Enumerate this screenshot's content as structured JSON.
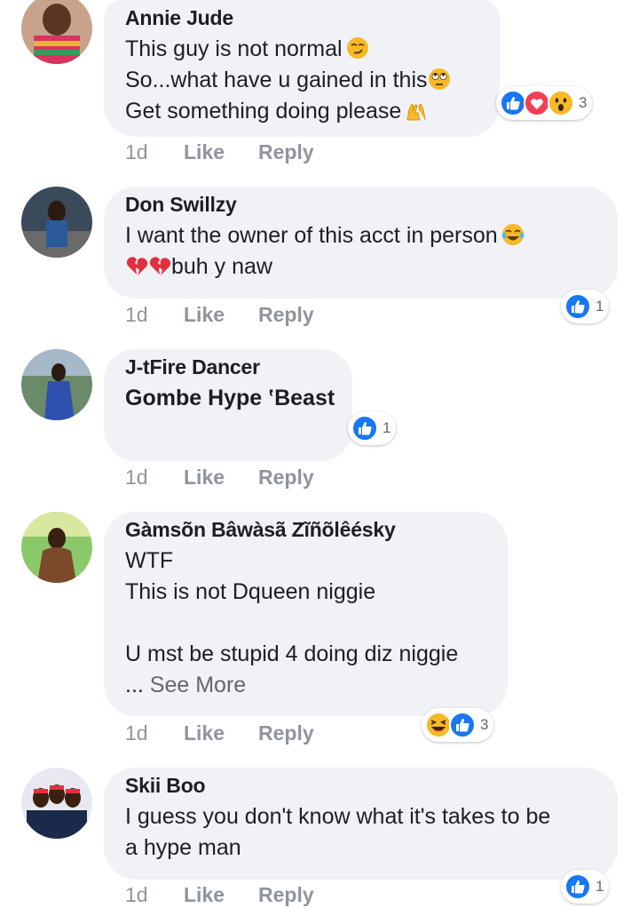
{
  "actions": {
    "like_label": "Like",
    "reply_label": "Reply"
  },
  "comments": [
    {
      "author": "Annie Jude",
      "lines": [
        "This guy is not normal",
        "So...what have u gained in this",
        "Get something doing please"
      ],
      "time": "1d",
      "reactions": {
        "icons": [
          "like-icon",
          "love-icon",
          "wow-icon"
        ],
        "count": "3"
      }
    },
    {
      "author": "Don Swillzy",
      "lines": [
        "I want the owner of this acct in person",
        "buh y naw"
      ],
      "time": "1d",
      "reactions": {
        "icons": [
          "like-icon"
        ],
        "count": "1"
      }
    },
    {
      "author": "J-tFire Dancer",
      "lines": [
        "Gombe Hype ‛Beast"
      ],
      "time": "1d",
      "reactions": {
        "icons": [
          "like-icon"
        ],
        "count": "1"
      }
    },
    {
      "author": "Gàmsõn Bâwàsã Zĩñõlêésky",
      "lines": [
        "WTF",
        "This is not Dqueen niggie",
        "",
        "U mst be stupid 4 doing diz niggie"
      ],
      "see_more_prefix": "...",
      "see_more": "See More",
      "time": "1d",
      "reactions": {
        "icons": [
          "haha-icon",
          "like-icon"
        ],
        "count": "3"
      }
    },
    {
      "author": "Skii Boo",
      "lines": [
        "I guess you don't know what it's takes to be",
        "a hype man"
      ],
      "time": "1d",
      "reactions": {
        "icons": [
          "like-icon"
        ],
        "count": "1"
      }
    }
  ],
  "colors": {
    "bubble": "#f0f2f5",
    "like_blue": "#1877f2",
    "love_red": "#f33e58",
    "wow_yellow": "#f7b928",
    "meta_gray": "#90949c"
  }
}
